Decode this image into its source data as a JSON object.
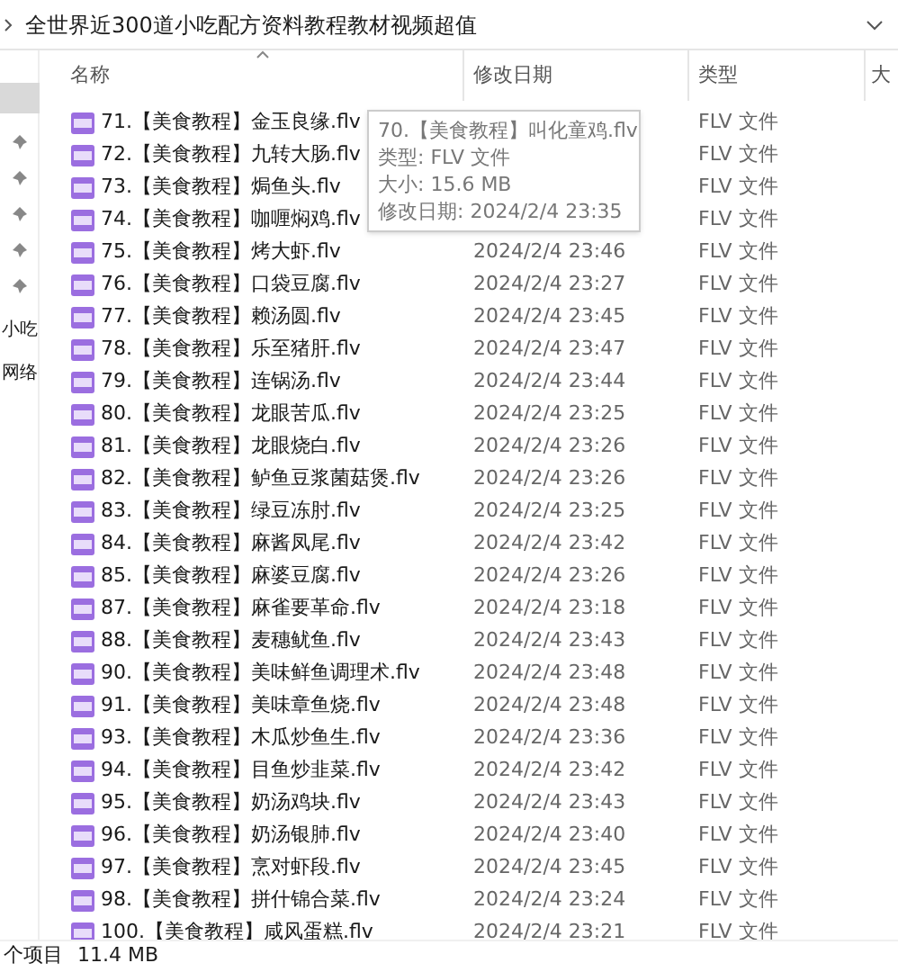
{
  "address_bar": {
    "path": "全世界近300道小吃配方资料教程教材视频超值"
  },
  "sidebar": {
    "items": [
      {
        "kind": "entry",
        "selected": true
      },
      {
        "kind": "pin"
      },
      {
        "kind": "pin"
      },
      {
        "kind": "pin"
      },
      {
        "kind": "pin"
      },
      {
        "kind": "pin"
      },
      {
        "kind": "entry",
        "label": "小吃",
        "selected": false
      },
      {
        "kind": "entry",
        "label": "网络",
        "selected": false
      }
    ]
  },
  "table": {
    "columns": [
      {
        "label": "名称",
        "sorted": true
      },
      {
        "label": "修改日期",
        "sorted": false
      },
      {
        "label": "类型",
        "sorted": false
      },
      {
        "label": "大",
        "sorted": false
      }
    ],
    "rows": [
      {
        "name": "71.【美食教程】金玉良缘.flv",
        "type": "FLV 文件"
      },
      {
        "name": "72.【美食教程】九转大肠.flv",
        "type": "FLV 文件"
      },
      {
        "name": "73.【美食教程】焗鱼头.flv",
        "type": "FLV 文件"
      },
      {
        "name": "74.【美食教程】咖喱焖鸡.flv",
        "type": "FLV 文件"
      },
      {
        "name": "75.【美食教程】烤大虾.flv",
        "date": "2024/2/4 23:46",
        "type": "FLV 文件"
      },
      {
        "name": "76.【美食教程】口袋豆腐.flv",
        "date": "2024/2/4 23:27",
        "type": "FLV 文件"
      },
      {
        "name": "77.【美食教程】赖汤圆.flv",
        "date": "2024/2/4 23:45",
        "type": "FLV 文件"
      },
      {
        "name": "78.【美食教程】乐至猪肝.flv",
        "date": "2024/2/4 23:47",
        "type": "FLV 文件"
      },
      {
        "name": "79.【美食教程】连锅汤.flv",
        "date": "2024/2/4 23:44",
        "type": "FLV 文件"
      },
      {
        "name": "80.【美食教程】龙眼苦瓜.flv",
        "date": "2024/2/4 23:25",
        "type": "FLV 文件"
      },
      {
        "name": "81.【美食教程】龙眼烧白.flv",
        "date": "2024/2/4 23:26",
        "type": "FLV 文件"
      },
      {
        "name": "82.【美食教程】鲈鱼豆浆菌菇煲.flv",
        "date": "2024/2/4 23:26",
        "type": "FLV 文件"
      },
      {
        "name": "83.【美食教程】绿豆冻肘.flv",
        "date": "2024/2/4 23:25",
        "type": "FLV 文件"
      },
      {
        "name": "84.【美食教程】麻酱凤尾.flv",
        "date": "2024/2/4 23:42",
        "type": "FLV 文件"
      },
      {
        "name": "85.【美食教程】麻婆豆腐.flv",
        "date": "2024/2/4 23:26",
        "type": "FLV 文件"
      },
      {
        "name": "87.【美食教程】麻雀要革命.flv",
        "date": "2024/2/4 23:18",
        "type": "FLV 文件"
      },
      {
        "name": "88.【美食教程】麦穗鱿鱼.flv",
        "date": "2024/2/4 23:43",
        "type": "FLV 文件"
      },
      {
        "name": "90.【美食教程】美味鲜鱼调理术.flv",
        "date": "2024/2/4 23:48",
        "type": "FLV 文件"
      },
      {
        "name": "91.【美食教程】美味章鱼烧.flv",
        "date": "2024/2/4 23:48",
        "type": "FLV 文件"
      },
      {
        "name": "93.【美食教程】木瓜炒鱼生.flv",
        "date": "2024/2/4 23:36",
        "type": "FLV 文件"
      },
      {
        "name": "94.【美食教程】目鱼炒韭菜.flv",
        "date": "2024/2/4 23:42",
        "type": "FLV 文件"
      },
      {
        "name": "95.【美食教程】奶汤鸡块.flv",
        "date": "2024/2/4 23:43",
        "type": "FLV 文件"
      },
      {
        "name": "96.【美食教程】奶汤银肺.flv",
        "date": "2024/2/4 23:40",
        "type": "FLV 文件"
      },
      {
        "name": "97.【美食教程】烹对虾段.flv",
        "date": "2024/2/4 23:45",
        "type": "FLV 文件"
      },
      {
        "name": "98.【美食教程】拼什锦合菜.flv",
        "date": "2024/2/4 23:24",
        "type": "FLV 文件"
      },
      {
        "name": "100.【美食教程】咸风蛋糕.flv",
        "date": "2024/2/4 23:21",
        "type": "FLV 文件"
      }
    ]
  },
  "tooltip": {
    "lines": [
      "70.【美食教程】叫化童鸡.flv",
      "类型: FLV 文件",
      "大小: 15.6 MB",
      "修改日期: 2024/2/4 23:35"
    ]
  },
  "status_bar": {
    "count": "个项目",
    "size": "11.4 MB"
  }
}
